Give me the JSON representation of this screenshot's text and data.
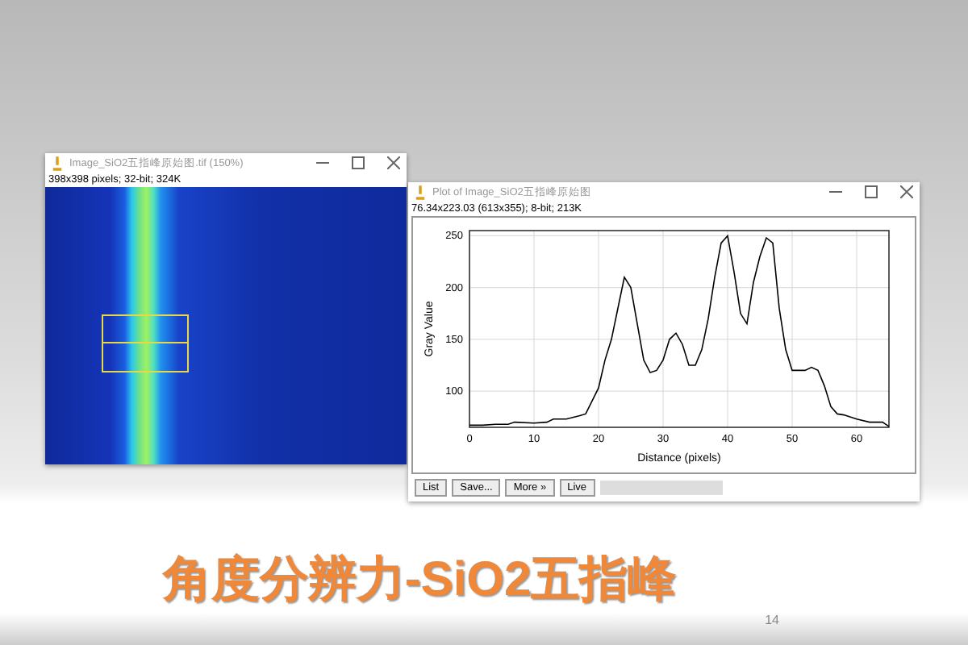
{
  "image_window": {
    "title": "Image_SiO2五指峰原始图.tif (150%)",
    "info": "398x398 pixels; 32-bit; 324K"
  },
  "plot_window": {
    "title": "Plot of Image_SiO2五指峰原始图",
    "info": "76.34x223.03  (613x355); 8-bit; 213K",
    "chart_data": {
      "type": "line",
      "grid": true,
      "xlabel": "Distance (pixels)",
      "ylabel": "Gray Value",
      "xlim": [
        0,
        65
      ],
      "ylim": [
        65,
        255
      ],
      "xticks": [
        0,
        10,
        20,
        30,
        40,
        50,
        60
      ],
      "yticks": [
        100,
        150,
        200,
        250
      ],
      "x": [
        0,
        2,
        4,
        6,
        7,
        10,
        12,
        13,
        15,
        17,
        18,
        20,
        21,
        22,
        24,
        25,
        26,
        27,
        28,
        29,
        30,
        31,
        32,
        33,
        34,
        35,
        36,
        37,
        38,
        39,
        40,
        41,
        42,
        43,
        44,
        45,
        46,
        47,
        48,
        49,
        50,
        51,
        52,
        53,
        54,
        55,
        56,
        57,
        58,
        60,
        62,
        64,
        65
      ],
      "series": [
        {
          "color": "#000000",
          "values": [
            67,
            67,
            68,
            68,
            70,
            69,
            70,
            73,
            73,
            76,
            78,
            103,
            130,
            150,
            210,
            200,
            165,
            130,
            118,
            120,
            130,
            150,
            156,
            145,
            125,
            125,
            140,
            170,
            210,
            243,
            250,
            215,
            175,
            165,
            205,
            230,
            248,
            243,
            180,
            140,
            120,
            120,
            120,
            123,
            120,
            105,
            85,
            78,
            77,
            73,
            70,
            70,
            66
          ]
        }
      ]
    },
    "buttons": [
      "List",
      "Save...",
      "More »",
      "Live"
    ]
  },
  "title": "角度分辨力-SiO2五指峰",
  "page_number": "14"
}
